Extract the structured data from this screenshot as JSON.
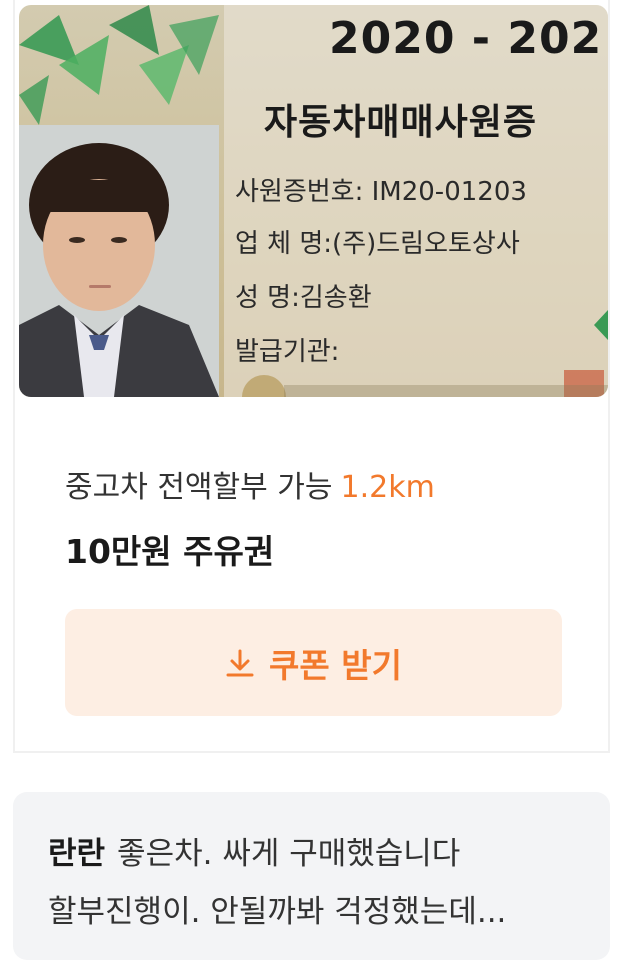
{
  "listing": {
    "id_card": {
      "year": "2020 - 202",
      "title": "자동차매매사원증",
      "employee_no": "사원증번호: IM20-01203",
      "company": "업 체 명:(주)드림오토상사",
      "name": "성     명:김송환",
      "issuer": "발급기관:"
    },
    "description": "중고차 전액할부 가능",
    "distance": "1.2km",
    "coupon_title": "10만원 주유권",
    "coupon_button_label": "쿠폰 받기",
    "accent_color": "#f2792c"
  },
  "review": {
    "author": "란란",
    "line1": "좋은차. 싸게 구매했습니다",
    "line2": "할부진행이. 안될까봐 걱정했는데..."
  }
}
